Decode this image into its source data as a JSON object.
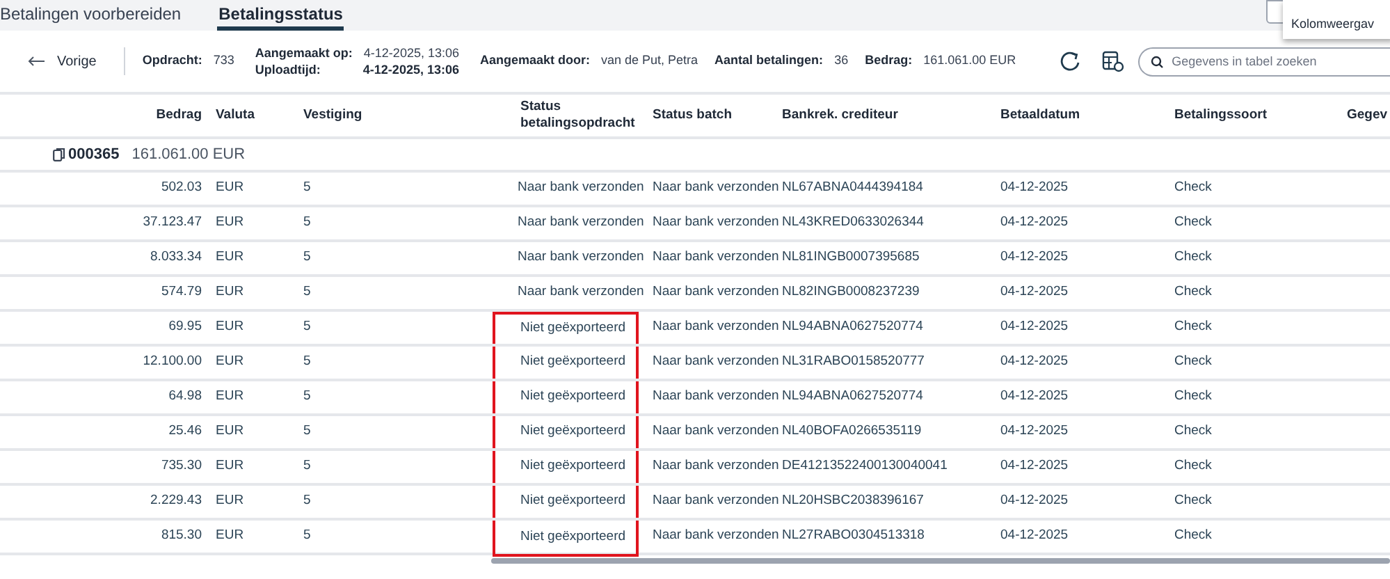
{
  "tabs": [
    {
      "label": "Betalingen voorbereiden",
      "selected": false
    },
    {
      "label": "Betalingsstatus",
      "selected": true
    }
  ],
  "menu": {
    "items": [
      "Kolomweergav"
    ]
  },
  "toolbar": {
    "back": "Vorige",
    "fields": [
      {
        "label": "Opdracht:",
        "value": "733",
        "bold": false
      },
      {
        "label": "Aangemaakt op:",
        "value": "4-12-2025, 13:06",
        "bold": false
      },
      {
        "label": "Uploadtijd:",
        "value": "4-12-2025, 13:06",
        "bold": true
      },
      {
        "label": "Aangemaakt door:",
        "value": "van de Put, Petra",
        "bold": false
      },
      {
        "label": "Aantal betalingen:",
        "value": "36",
        "bold": false
      },
      {
        "label": "Bedrag:",
        "value": "161.061.00 EUR",
        "bold": false
      }
    ],
    "search": {
      "placeholder": "Gegevens in tabel zoeken"
    }
  },
  "table": {
    "columns": [
      "Bedrag",
      "Valuta",
      "Vestiging",
      "Status betalingsopdracht",
      "Status batch",
      "Bankrek. crediteur",
      "Betaaldatum",
      "Betalingssoort",
      "Gegev"
    ],
    "group": {
      "id": "000365",
      "total": "161.061.00 EUR"
    },
    "rows": [
      {
        "cells": [
          "502.03",
          "EUR",
          "5",
          "Naar bank verzonden",
          "Naar bank verzonden",
          "NL67ABNA0444394184",
          "04-12-2025",
          "Check"
        ],
        "highlighted": false
      },
      {
        "cells": [
          "37.123.47",
          "EUR",
          "5",
          "Naar bank verzonden",
          "Naar bank verzonden",
          "NL43KRED0633026344",
          "04-12-2025",
          "Check"
        ],
        "highlighted": false
      },
      {
        "cells": [
          "8.033.34",
          "EUR",
          "5",
          "Naar bank verzonden",
          "Naar bank verzonden",
          "NL81INGB0007395685",
          "04-12-2025",
          "Check"
        ],
        "highlighted": false
      },
      {
        "cells": [
          "574.79",
          "EUR",
          "5",
          "Naar bank verzonden",
          "Naar bank verzonden",
          "NL82INGB0008237239",
          "04-12-2025",
          "Check"
        ],
        "highlighted": false
      },
      {
        "cells": [
          "69.95",
          "EUR",
          "5",
          "Niet geëxporteerd",
          "Naar bank verzonden",
          "NL94ABNA0627520774",
          "04-12-2025",
          "Check"
        ],
        "highlighted": true
      },
      {
        "cells": [
          "12.100.00",
          "EUR",
          "5",
          "Niet geëxporteerd",
          "Naar bank verzonden",
          "NL31RABO0158520777",
          "04-12-2025",
          "Check"
        ],
        "highlighted": true
      },
      {
        "cells": [
          "64.98",
          "EUR",
          "5",
          "Niet geëxporteerd",
          "Naar bank verzonden",
          "NL94ABNA0627520774",
          "04-12-2025",
          "Check"
        ],
        "highlighted": true
      },
      {
        "cells": [
          "25.46",
          "EUR",
          "5",
          "Niet geëxporteerd",
          "Naar bank verzonden",
          "NL40BOFA0266535119",
          "04-12-2025",
          "Check"
        ],
        "highlighted": true
      },
      {
        "cells": [
          "735.30",
          "EUR",
          "5",
          "Niet geëxporteerd",
          "Naar bank verzonden",
          "DE41213522400130040041",
          "04-12-2025",
          "Check"
        ],
        "highlighted": true
      },
      {
        "cells": [
          "2.229.43",
          "EUR",
          "5",
          "Niet geëxporteerd",
          "Naar bank verzonden",
          "NL20HSBC2038396167",
          "04-12-2025",
          "Check"
        ],
        "highlighted": true
      },
      {
        "cells": [
          "815.30",
          "EUR",
          "5",
          "Niet geëxporteerd",
          "Naar bank verzonden",
          "NL27RABO0304513318",
          "04-12-2025",
          "Check"
        ],
        "highlighted": true
      }
    ]
  }
}
